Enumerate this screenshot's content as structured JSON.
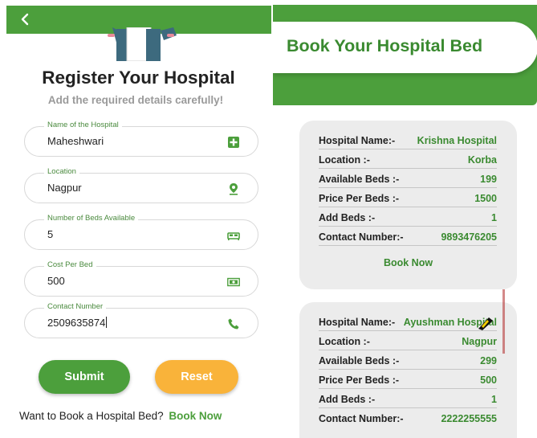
{
  "register": {
    "back_icon": "chevron-left-icon",
    "title": "Register Your Hospital",
    "subtitle": "Add the required details carefully!",
    "fields": [
      {
        "label": "Name of the Hospital",
        "value": "Maheshwari",
        "icon": "hospital-plus-icon"
      },
      {
        "label": "Location",
        "value": "Nagpur",
        "icon": "location-pin-icon"
      },
      {
        "label": "Number of Beds Available",
        "value": "5",
        "icon": "bed-icon"
      },
      {
        "label": "Cost Per Bed",
        "value": "500",
        "icon": "money-icon"
      },
      {
        "label": "Contact Number",
        "value": "2509635874",
        "icon": "phone-icon"
      }
    ],
    "submit_label": "Submit",
    "reset_label": "Reset",
    "bottom_prompt": "Want to Book a Hospital Bed?",
    "bottom_link": "Book Now"
  },
  "booking": {
    "title": "Book Your Hospital Bed",
    "cards": [
      {
        "rows": [
          {
            "label": "Hospital Name:-",
            "value": "Krishna Hospital"
          },
          {
            "label": "Location :-",
            "value": "Korba"
          },
          {
            "label": "Available Beds :-",
            "value": "199"
          },
          {
            "label": "Price Per Beds :-",
            "value": "1500"
          },
          {
            "label": "Add Beds :-",
            "value": "1"
          },
          {
            "label": "Contact Number:-",
            "value": "9893476205"
          }
        ],
        "book_now": "Book Now"
      },
      {
        "rows": [
          {
            "label": "Hospital Name:-",
            "value": "Ayushman Hospital"
          },
          {
            "label": "Location :-",
            "value": "Nagpur"
          },
          {
            "label": "Available Beds :-",
            "value": "299"
          },
          {
            "label": "Price Per Beds :-",
            "value": "500"
          },
          {
            "label": "Add Beds :-",
            "value": "1"
          },
          {
            "label": "Contact Number:-",
            "value": "2222255555"
          }
        ]
      }
    ]
  },
  "colors": {
    "primary_green": "#4c9f3c",
    "text_green": "#3a8a30",
    "reset_orange": "#f9b33a",
    "card_grey": "#ececec"
  }
}
